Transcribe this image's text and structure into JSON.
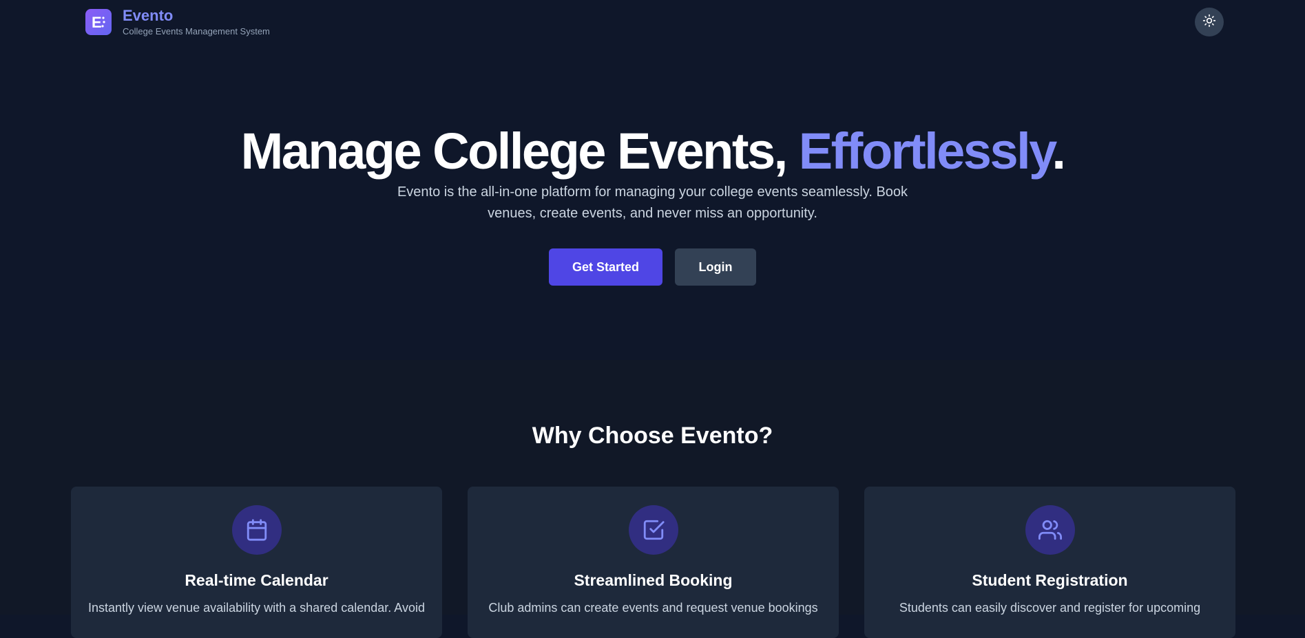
{
  "header": {
    "logo_letter": "E",
    "app_name": "Evento",
    "tagline": "College Events Management System",
    "theme_toggle_icon": "sun-icon"
  },
  "hero": {
    "title_main": "Manage College Events, ",
    "title_accent": "Effortlessly",
    "title_end": ".",
    "description": "Evento is the all-in-one platform for managing your college events seamlessly. Book venues, create events, and never miss an opportunity.",
    "primary_button": "Get Started",
    "secondary_button": "Login"
  },
  "features": {
    "title": "Why Choose Evento?",
    "cards": [
      {
        "icon": "calendar-icon",
        "title": "Real-time Calendar",
        "description": "Instantly view venue availability with a shared calendar. Avoid"
      },
      {
        "icon": "check-square-icon",
        "title": "Streamlined Booking",
        "description": "Club admins can create events and request venue bookings"
      },
      {
        "icon": "users-icon",
        "title": "Student Registration",
        "description": "Students can easily discover and register for upcoming"
      }
    ]
  },
  "colors": {
    "background": "#0f172a",
    "section_background": "#111827",
    "card_background": "#1e293b",
    "accent": "#818cf8",
    "primary_button": "#4f46e5",
    "secondary_button": "#334155",
    "icon_circle": "#312e81"
  }
}
